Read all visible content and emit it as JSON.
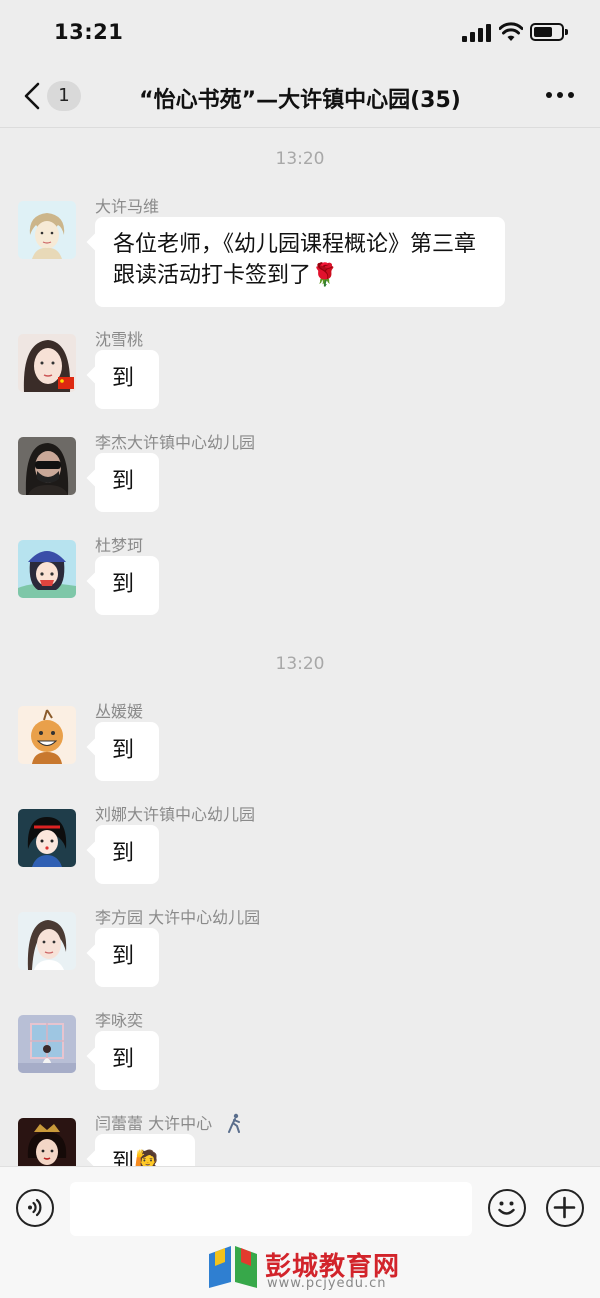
{
  "status_bar": {
    "time": "13:21"
  },
  "nav": {
    "badge_count": "1",
    "title": "“怡心书苑”—大许镇中心园(35)"
  },
  "timestamps": [
    "13:20",
    "13:20"
  ],
  "messages": [
    {
      "sender": "大许马维",
      "text": "各位老师，《幼儿园课程概论》第三章跟读活动打卡签到了",
      "emoji": "🌹"
    },
    {
      "sender": "沈雪桃",
      "text": "到"
    },
    {
      "sender": "李杰大许镇中心幼儿园",
      "text": "到"
    },
    {
      "sender": "杜梦珂",
      "text": "到"
    },
    {
      "sender": "丛媛媛",
      "text": "到"
    },
    {
      "sender": "刘娜大许镇中心幼儿园",
      "text": "到"
    },
    {
      "sender": "李方园 大许中心幼儿园",
      "text": "到"
    },
    {
      "sender": "李咏奕",
      "text": "到"
    },
    {
      "sender": "闫蕾蕾 大许中心",
      "text": "到",
      "emoji": "🙋"
    }
  ],
  "watermark": {
    "text": "彭城教育网",
    "url": "www.pcjyedu.cn"
  },
  "icons": [
    "signal-icon",
    "wifi-icon",
    "battery-icon",
    "back-chevron-icon",
    "more-icon",
    "voice-icon",
    "emoji-icon",
    "plus-icon"
  ]
}
